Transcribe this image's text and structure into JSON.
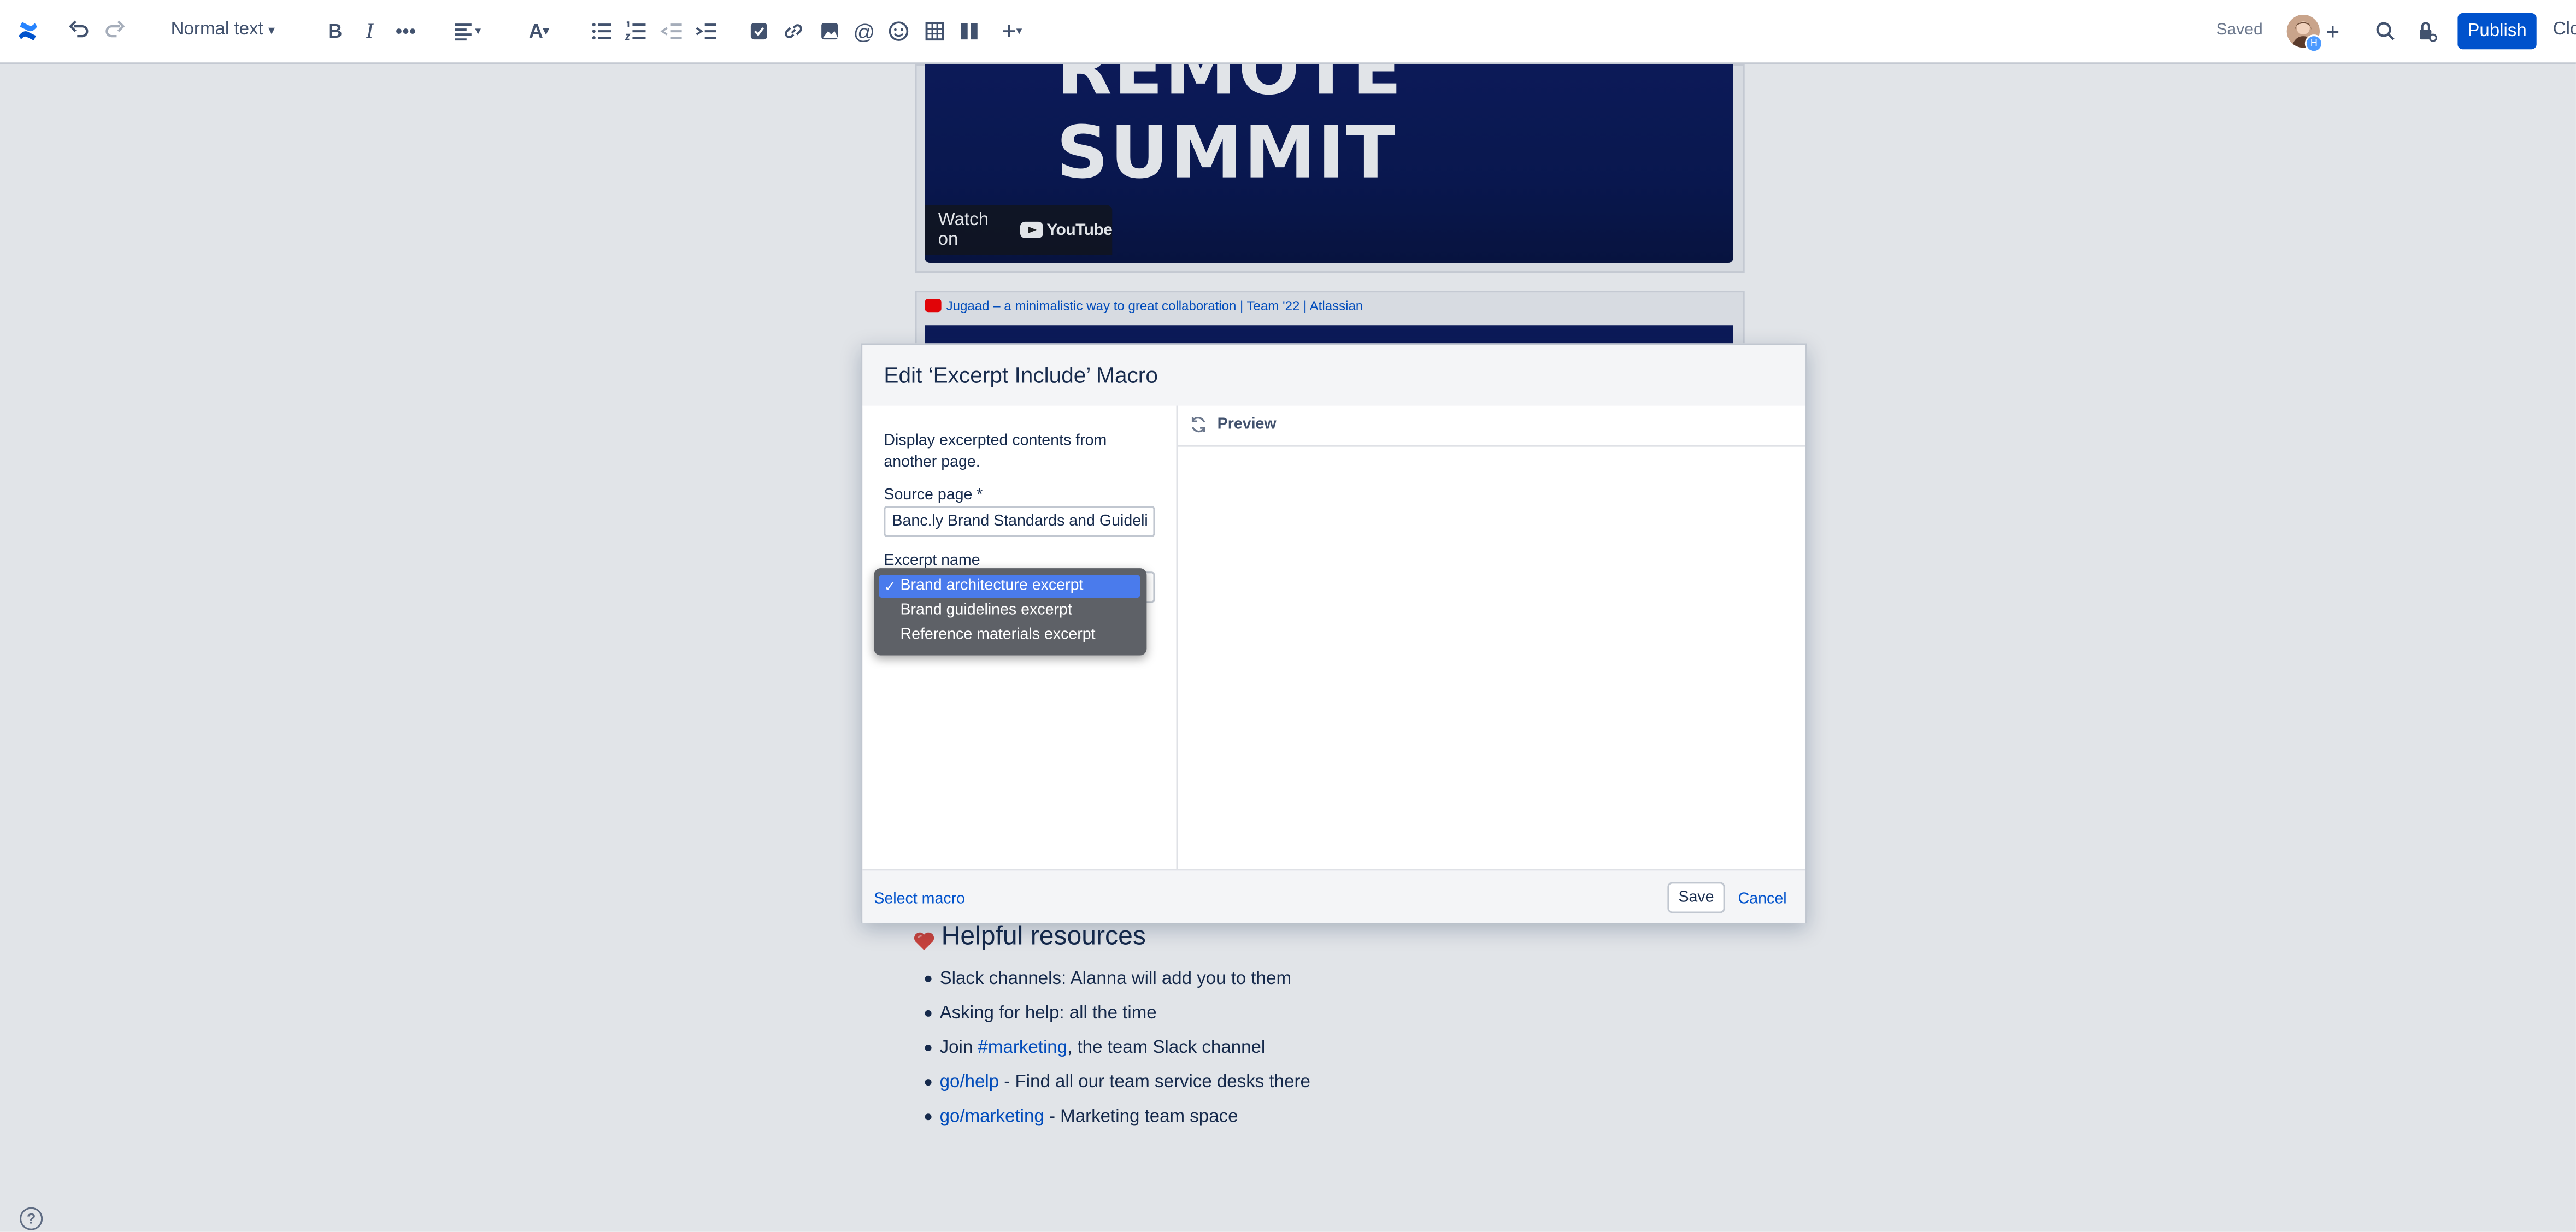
{
  "toolbar": {
    "text_style": "Normal text",
    "saved_label": "Saved",
    "publish_label": "Publish",
    "close_label": "Clo",
    "avatar_badge": "H"
  },
  "page": {
    "video1": {
      "thumb_text": "REMOTE SUMMIT",
      "watch_on": "Watch on",
      "youtube_label": "YouTube"
    },
    "video2_title": "Jugaad – a minimalistic way to great collaboration | Team '22 | Atlassian",
    "heading": "Helpful resources",
    "bullets": {
      "b1": "Slack channels: Alanna will add you to them",
      "b2": "Asking for help: all the time",
      "b3_prefix": "Join ",
      "b3_link": "#marketing",
      "b3_suffix": ", the team Slack channel",
      "b4_link": "go/help",
      "b4_suffix": " - Find all our team service desks there",
      "b5_link": "go/marketing",
      "b5_suffix": " - Marketing team space"
    }
  },
  "dialog": {
    "title": "Edit ‘Excerpt Include’ Macro",
    "description": "Display excerpted contents from another page.",
    "source_label": "Source page *",
    "source_value": "Banc.ly Brand Standards and Guideli",
    "excerpt_label": "Excerpt name",
    "preview_label": "Preview",
    "select_macro": "Select macro",
    "save": "Save",
    "cancel": "Cancel"
  },
  "dropdown": {
    "check": "✓",
    "options": [
      "Brand architecture excerpt",
      "Brand guidelines excerpt",
      "Reference materials excerpt"
    ]
  },
  "help_icon": "?",
  "colors": {
    "brand": "#0052cc",
    "dropdown_bg": "#5e6167",
    "dropdown_selected": "#4a7bec"
  }
}
